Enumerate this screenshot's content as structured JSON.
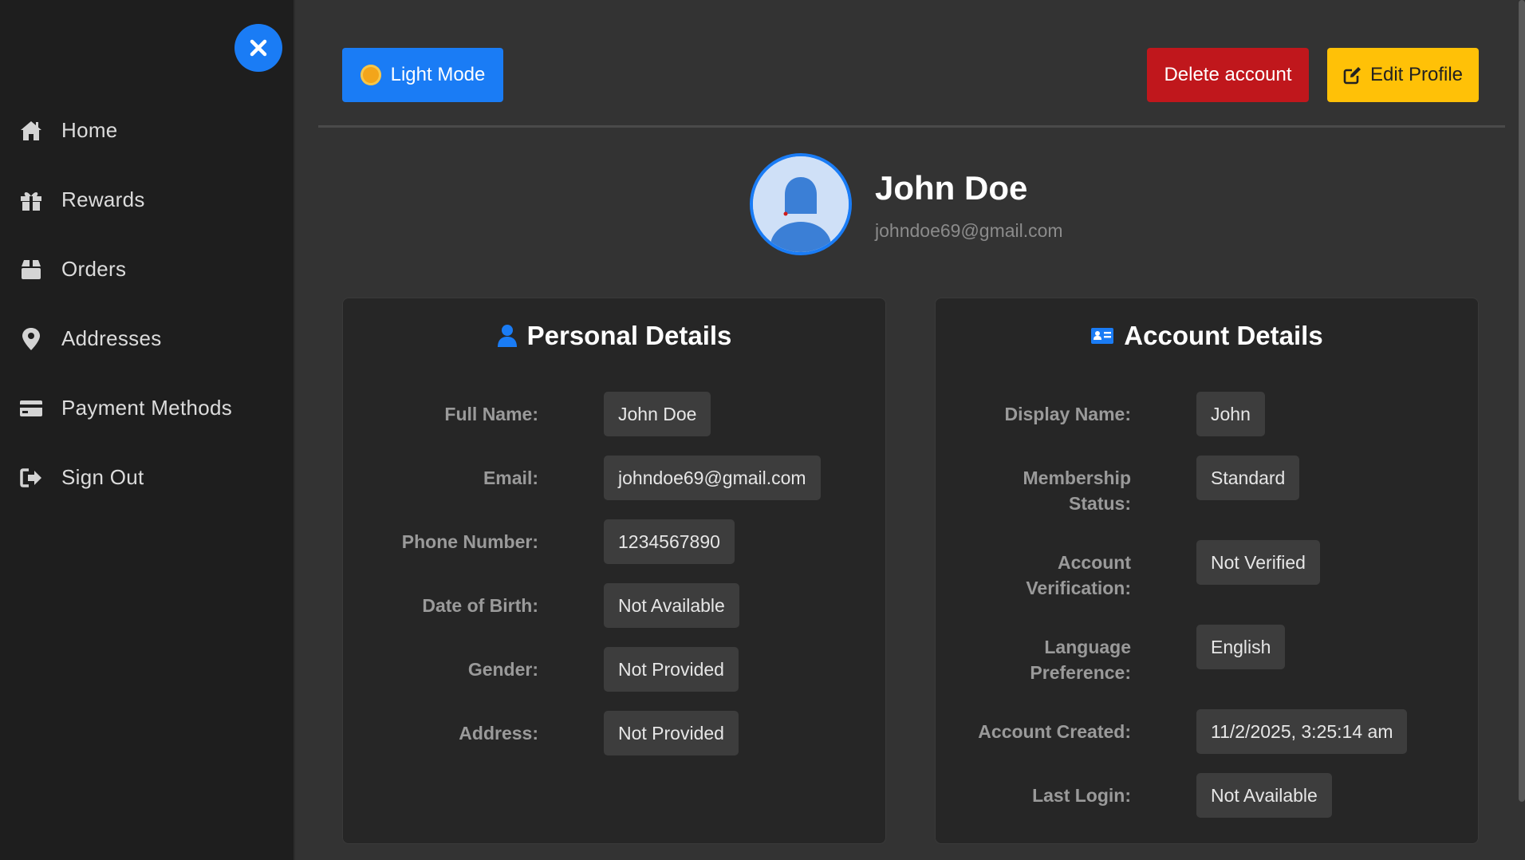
{
  "sidebar": {
    "items": [
      {
        "label": "Home",
        "icon": "home-icon"
      },
      {
        "label": "Rewards",
        "icon": "gift-icon"
      },
      {
        "label": "Orders",
        "icon": "box-icon"
      },
      {
        "label": "Addresses",
        "icon": "map-pin-icon"
      },
      {
        "label": "Payment Methods",
        "icon": "credit-card-icon"
      },
      {
        "label": "Sign Out",
        "icon": "sign-out-icon"
      }
    ]
  },
  "toolbar": {
    "theme_label": "Light Mode",
    "delete_label": "Delete account",
    "edit_label": "Edit Profile"
  },
  "profile": {
    "name": "John Doe",
    "email": "johndoe69@gmail.com"
  },
  "personal": {
    "title": "Personal Details",
    "fields": [
      {
        "label": "Full Name:",
        "value": "John Doe"
      },
      {
        "label": "Email:",
        "value": "johndoe69@gmail.com"
      },
      {
        "label": "Phone Number:",
        "value": "1234567890"
      },
      {
        "label": "Date of Birth:",
        "value": "Not Available"
      },
      {
        "label": "Gender:",
        "value": "Not Provided"
      },
      {
        "label": "Address:",
        "value": "Not Provided"
      }
    ]
  },
  "account": {
    "title": "Account Details",
    "fields": [
      {
        "label": "Display Name:",
        "value": "John"
      },
      {
        "label": "Membership Status:",
        "value": "Standard"
      },
      {
        "label": "Account Verification:",
        "value": "Not Verified"
      },
      {
        "label": "Language Preference:",
        "value": "English"
      },
      {
        "label": "Account Created:",
        "value": "11/2/2025, 3:25:14 am"
      },
      {
        "label": "Last Login:",
        "value": "Not Available"
      }
    ]
  },
  "colors": {
    "accent": "#1a7cf5",
    "danger": "#c0171c",
    "warning": "#ffc107",
    "sidebar_bg": "#1e1e1e",
    "main_bg": "#333333",
    "card_bg": "#262626"
  }
}
